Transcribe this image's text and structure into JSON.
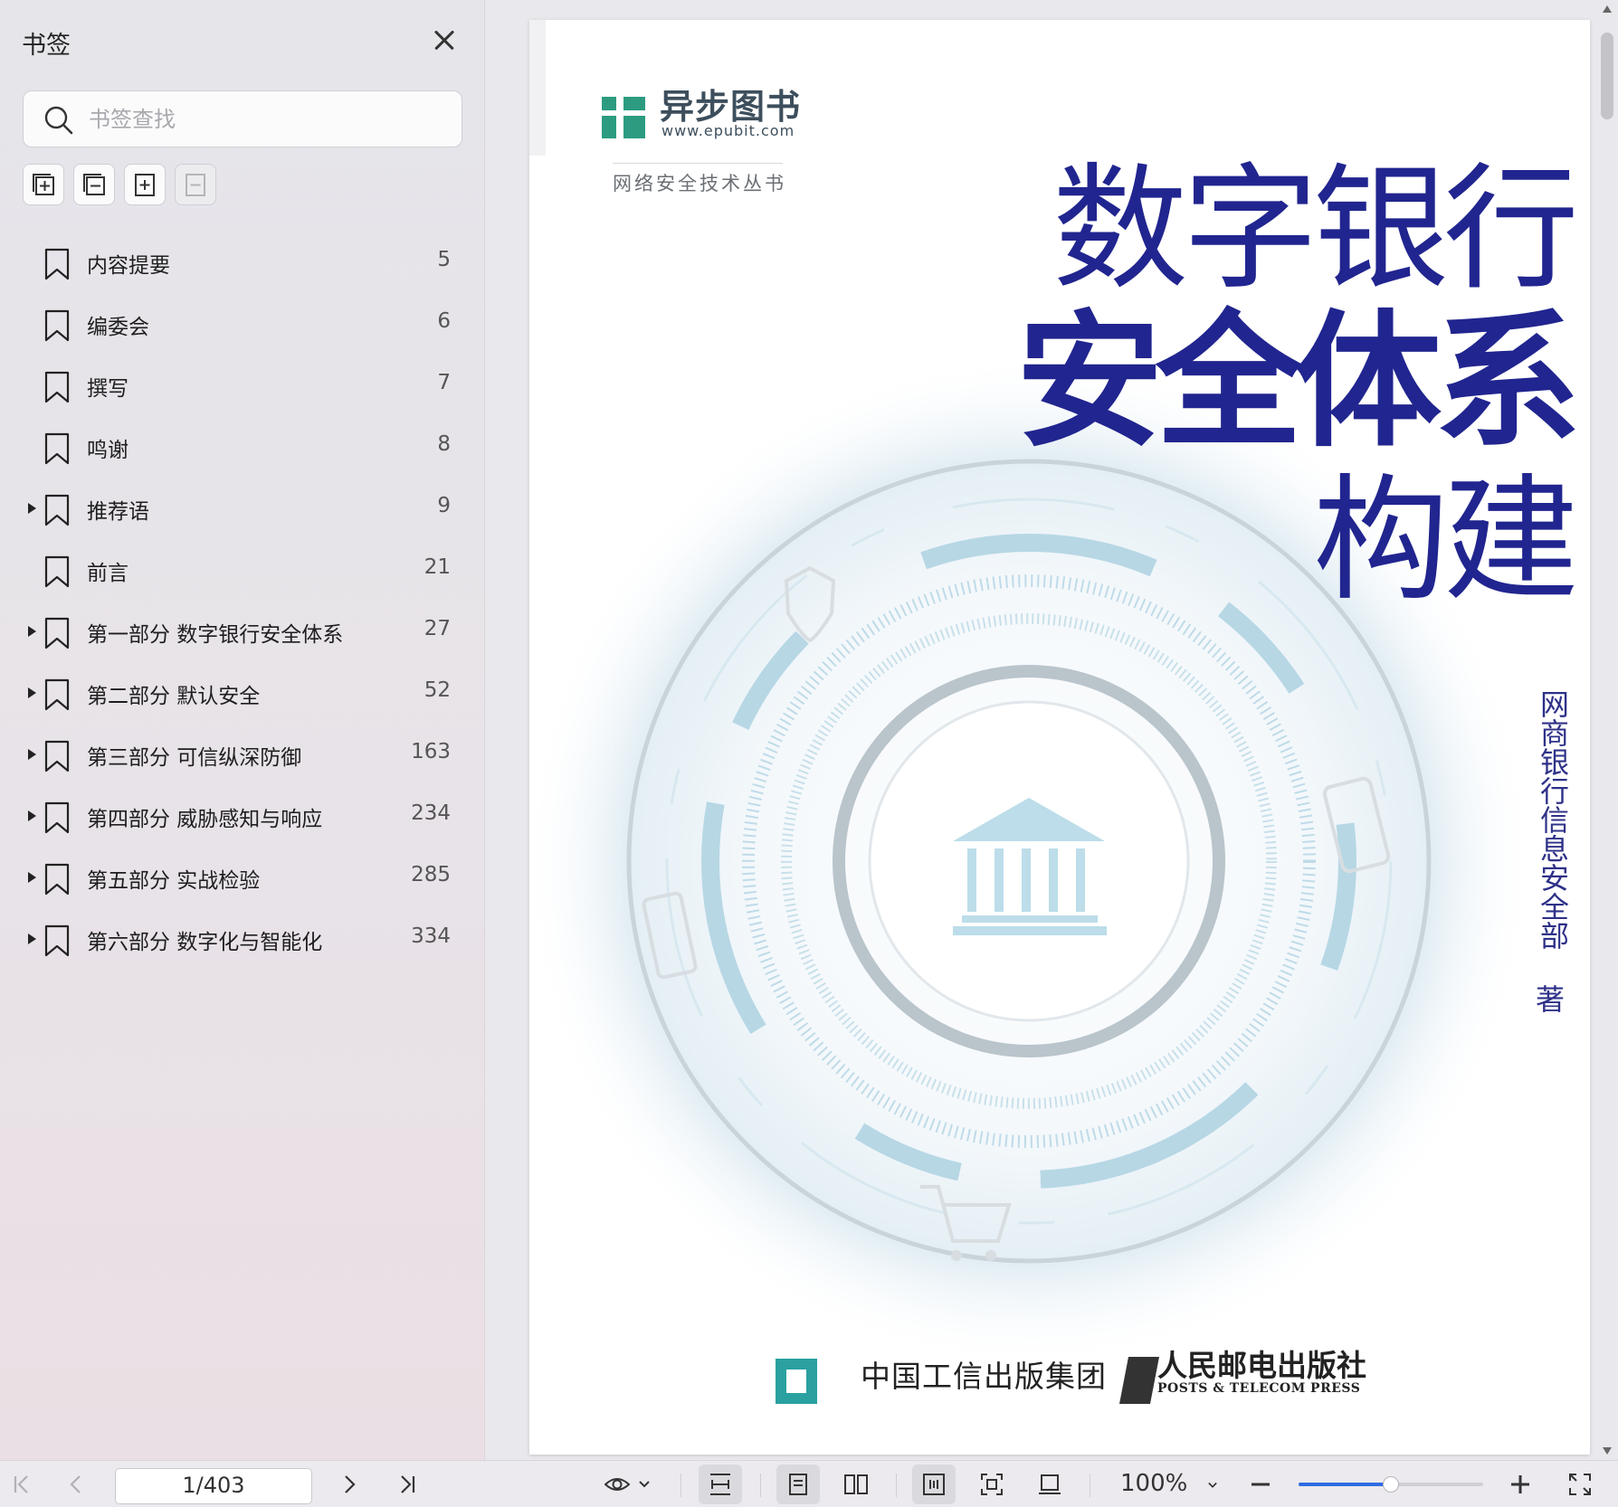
{
  "sidebar": {
    "title": "书签",
    "search_placeholder": "书签查找",
    "items": [
      {
        "label": "内容提要",
        "page": "5",
        "expandable": false
      },
      {
        "label": "编委会",
        "page": "6",
        "expandable": false
      },
      {
        "label": "撰写",
        "page": "7",
        "expandable": false
      },
      {
        "label": "鸣谢",
        "page": "8",
        "expandable": false
      },
      {
        "label": "推荐语",
        "page": "9",
        "expandable": true
      },
      {
        "label": "前言",
        "page": "21",
        "expandable": false
      },
      {
        "label": "第一部分  数字银行安全体系",
        "page": "27",
        "expandable": true
      },
      {
        "label": "第二部分  默认安全",
        "page": "52",
        "expandable": true
      },
      {
        "label": "第三部分  可信纵深防御",
        "page": "163",
        "expandable": true
      },
      {
        "label": "第四部分  威胁感知与响应",
        "page": "234",
        "expandable": true
      },
      {
        "label": "第五部分  实战检验",
        "page": "285",
        "expandable": true
      },
      {
        "label": "第六部分  数字化与智能化",
        "page": "334",
        "expandable": true
      }
    ]
  },
  "cover": {
    "brand_name": "异步图书",
    "brand_url": "www.epubit.com",
    "series": "网络安全技术丛书",
    "title_line1": "数字银行",
    "title_line2": "安全体系",
    "title_line3": "构建",
    "author": "网商银行信息安全部",
    "author_suffix": "著",
    "publisher_group": "中国工信出版集团",
    "publisher_press": "人民邮电出版社",
    "publisher_press_en": "POSTS & TELECOM PRESS",
    "colors": {
      "title": "#21258f",
      "ring": "#7fb6cf"
    }
  },
  "toolbar": {
    "page_indicator": "1/403",
    "zoom": "100%",
    "zoom_slider_fraction": 0.5
  }
}
